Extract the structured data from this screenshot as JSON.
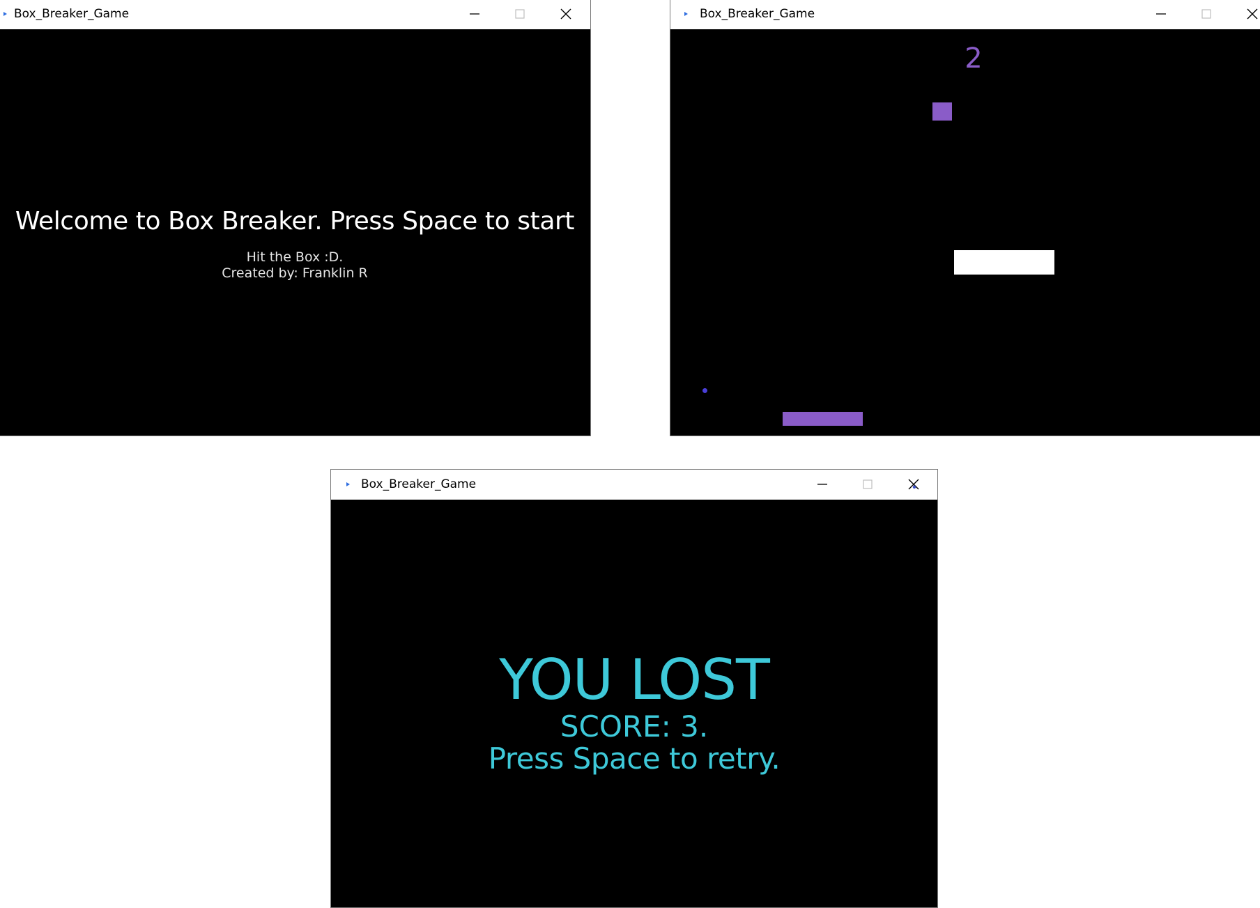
{
  "windows": {
    "start": {
      "title": "Box_Breaker_Game",
      "headline": "Welcome to Box Breaker. Press Space to start",
      "subline1": "Hit the Box :D.",
      "subline2": "Created by: Franklin R"
    },
    "play": {
      "title": "Box_Breaker_Game",
      "score": "2"
    },
    "lost": {
      "title": "Box_Breaker_Game",
      "headline": "YOU LOST",
      "score_line": "SCORE: 3.",
      "retry_line": "Press Space to retry."
    }
  },
  "icons": {
    "app": "app-icon",
    "minimize": "minimize-icon",
    "maximize": "maximize-icon",
    "close": "close-icon"
  },
  "colors": {
    "background": "#000000",
    "text_white": "#ffffff",
    "score_purple": "#8a5cc8",
    "target_box": "#8a5cc8",
    "paddle": "#8a5cc8",
    "ball": "#4a3fd8",
    "block": "#ffffff",
    "lost_text": "#3ec9d9",
    "app_icon": "#2f6ee0"
  }
}
